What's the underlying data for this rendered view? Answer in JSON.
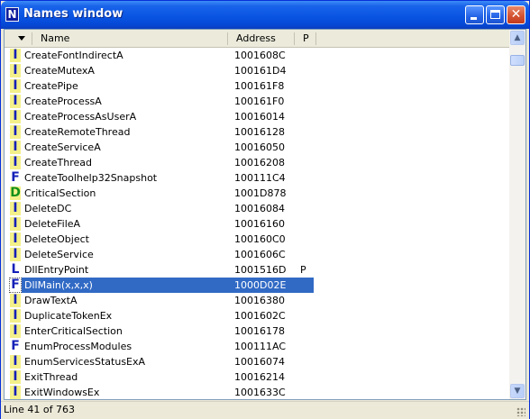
{
  "window": {
    "title": "Names window",
    "icon_letter": "N",
    "icon_name": "ida-names-icon",
    "controls": {
      "minimize": "minimize-icon",
      "maximize": "maximize-icon",
      "close": "✕"
    }
  },
  "columns": {
    "name": "Name",
    "address": "Address",
    "public": "P"
  },
  "rows": [
    {
      "type": "I",
      "name": "CreateFontIndirectA",
      "address": "1001608C",
      "public": ""
    },
    {
      "type": "I",
      "name": "CreateMutexA",
      "address": "100161D4",
      "public": ""
    },
    {
      "type": "I",
      "name": "CreatePipe",
      "address": "100161F8",
      "public": ""
    },
    {
      "type": "I",
      "name": "CreateProcessA",
      "address": "100161F0",
      "public": ""
    },
    {
      "type": "I",
      "name": "CreateProcessAsUserA",
      "address": "10016014",
      "public": ""
    },
    {
      "type": "I",
      "name": "CreateRemoteThread",
      "address": "10016128",
      "public": ""
    },
    {
      "type": "I",
      "name": "CreateServiceA",
      "address": "10016050",
      "public": ""
    },
    {
      "type": "I",
      "name": "CreateThread",
      "address": "10016208",
      "public": ""
    },
    {
      "type": "F",
      "name": "CreateToolhelp32Snapshot",
      "address": "100111C4",
      "public": ""
    },
    {
      "type": "D",
      "name": "CriticalSection",
      "address": "1001D878",
      "public": ""
    },
    {
      "type": "I",
      "name": "DeleteDC",
      "address": "10016084",
      "public": ""
    },
    {
      "type": "I",
      "name": "DeleteFileA",
      "address": "10016160",
      "public": ""
    },
    {
      "type": "I",
      "name": "DeleteObject",
      "address": "100160C0",
      "public": ""
    },
    {
      "type": "I",
      "name": "DeleteService",
      "address": "1001606C",
      "public": ""
    },
    {
      "type": "L",
      "name": "DllEntryPoint",
      "address": "1001516D",
      "public": "P"
    },
    {
      "type": "F",
      "name": "DllMain(x,x,x)",
      "address": "1000D02E",
      "public": "",
      "selected": true
    },
    {
      "type": "I",
      "name": "DrawTextA",
      "address": "10016380",
      "public": ""
    },
    {
      "type": "I",
      "name": "DuplicateTokenEx",
      "address": "1001602C",
      "public": ""
    },
    {
      "type": "I",
      "name": "EnterCriticalSection",
      "address": "10016178",
      "public": ""
    },
    {
      "type": "F",
      "name": "EnumProcessModules",
      "address": "100111AC",
      "public": ""
    },
    {
      "type": "I",
      "name": "EnumServicesStatusExA",
      "address": "10016074",
      "public": ""
    },
    {
      "type": "I",
      "name": "ExitThread",
      "address": "10016214",
      "public": ""
    },
    {
      "type": "I",
      "name": "ExitWindowsEx",
      "address": "1001633C",
      "public": ""
    }
  ],
  "scrollbar": {
    "up": "▲",
    "down": "▼"
  },
  "status": {
    "text": "Line 41 of 763"
  },
  "colors": {
    "title_bar": "#0a55e3",
    "selection": "#316ac5",
    "badge_import_bg": "#f4f08a",
    "badge_blue": "#1420b8",
    "badge_green": "#12901a"
  }
}
